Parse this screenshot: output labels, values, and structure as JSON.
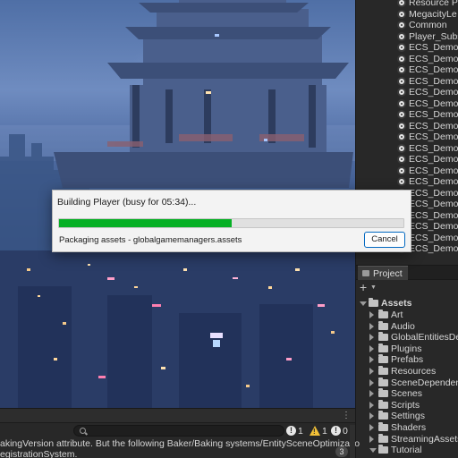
{
  "dialog": {
    "title": "Building Player (busy for 05:34)...",
    "status": "Packaging assets - globalgamemanagers.assets",
    "cancel_label": "Cancel",
    "progress": 0.5,
    "progress_color": "#06b025"
  },
  "hierarchy": {
    "items": [
      "Resource Pl",
      "MegacityLe",
      "Common",
      "Player_Subs",
      "ECS_Demo_",
      "ECS_Demo_",
      "ECS_Demo_",
      "ECS_Demo_",
      "ECS_Demo_",
      "ECS_Demo_",
      "ECS_Demo_",
      "ECS_Demo_",
      "ECS_Demo_",
      "ECS_Demo_",
      "ECS_Demo_",
      "ECS_Demo_",
      "ECS_Demo_",
      "ECS_Demo_",
      "ECS_Demo_",
      "ECS_Demo_",
      "ECS_Demo_",
      "ECS_Demo_",
      "ECS_Demo_"
    ],
    "icon": "scene-object-icon"
  },
  "project": {
    "tab_label": "Project",
    "add_label": "+",
    "root": "Assets",
    "folders": [
      "Art",
      "Audio",
      "GlobalEntitiesDe",
      "Plugins",
      "Prefabs",
      "Resources",
      "SceneDependen",
      "Scenes",
      "Scripts",
      "Settings",
      "Shaders",
      "StreamingAssets",
      "Tutorial"
    ]
  },
  "console": {
    "menu_label": "⋮",
    "info_count": "1",
    "warn_count": "1",
    "error_count": "0",
    "messages": [
      "akingVersion attribute. But the following Baker/Baking systems/EntitySceneOptimizatio",
      "egistrationSystem."
    ],
    "collapse_count": "3"
  },
  "colors": {
    "panel_bg": "#282828",
    "accent_button_border": "#0067c0",
    "warning": "#f2c037"
  }
}
